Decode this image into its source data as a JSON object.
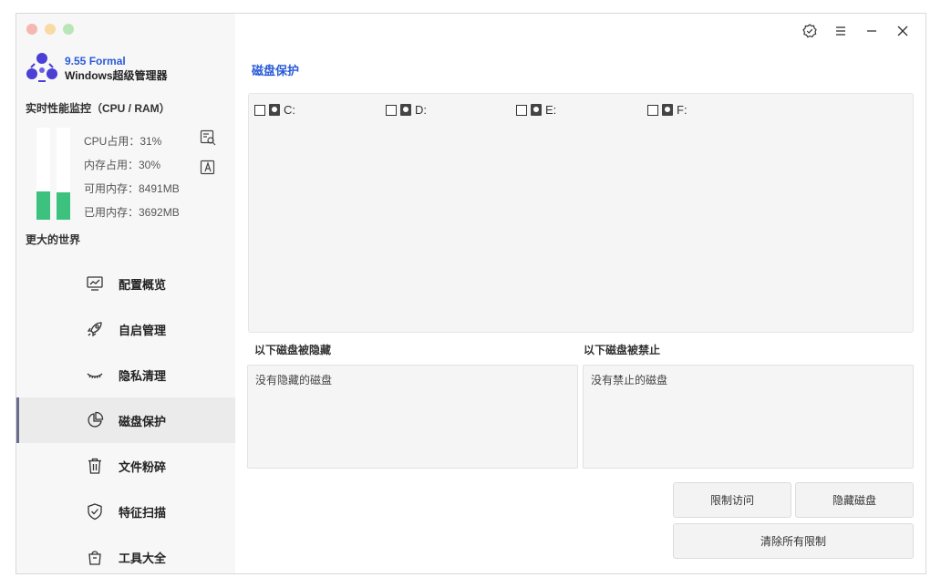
{
  "app": {
    "version": "9.55 Formal",
    "name": "Windows超级管理器"
  },
  "monitor": {
    "title": "实时性能监控（CPU / RAM）",
    "cpu_percent": 31,
    "ram_percent": 30,
    "cpu_usage": "CPU占用：31%",
    "mem_usage": "内存占用：30%",
    "mem_free": "可用内存：8491MB",
    "mem_used": "已用内存：3692MB",
    "bar_color": "#3cc17e",
    "slogan": "更大的世界"
  },
  "sidebar": {
    "items": [
      {
        "label": "配置概览",
        "icon": "chart-monitor-icon"
      },
      {
        "label": "自启管理",
        "icon": "rocket-icon"
      },
      {
        "label": "隐私清理",
        "icon": "closed-eye-icon"
      },
      {
        "label": "磁盘保护",
        "icon": "pie-chart-icon",
        "active": true
      },
      {
        "label": "文件粉碎",
        "icon": "trash-icon"
      },
      {
        "label": "特征扫描",
        "icon": "shield-check-icon"
      },
      {
        "label": "工具大全",
        "icon": "bag-icon"
      }
    ]
  },
  "main": {
    "title": "磁盘保护",
    "drives": [
      "C:",
      "D:",
      "E:",
      "F:"
    ],
    "hidden_label": "以下磁盘被隐藏",
    "hidden_empty": "没有隐藏的磁盘",
    "blocked_label": "以下磁盘被禁止",
    "blocked_empty": "没有禁止的磁盘",
    "btn_restrict": "限制访问",
    "btn_hide": "隐藏磁盘",
    "btn_clear": "清除所有限制"
  },
  "colors": {
    "accent": "#2a5bd7",
    "sidebar_bg": "#f7f7f7",
    "active_bg": "#ebebeb"
  }
}
